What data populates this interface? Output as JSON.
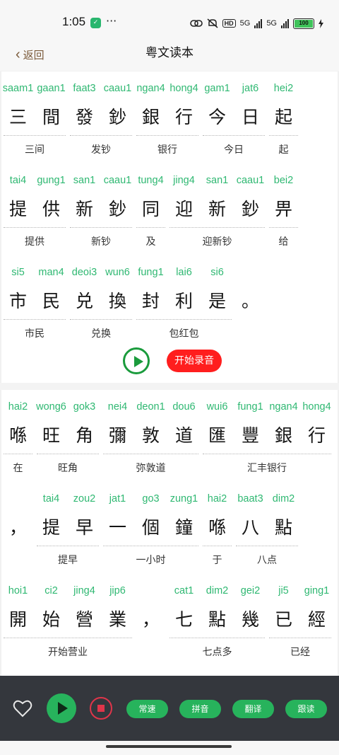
{
  "status": {
    "time": "1:05",
    "app_icon_glyph": "✓",
    "more": "···",
    "hd": "HD",
    "net1": "5G",
    "net2": "5G",
    "battery": "100"
  },
  "nav": {
    "back": "返回",
    "title": "粤文读本"
  },
  "sections": [
    {
      "rows": [
        {
          "cells": [
            [
              "saam1",
              "三"
            ],
            [
              "gaan1",
              "間"
            ],
            [
              "faat3",
              "發"
            ],
            [
              "caau1",
              "鈔"
            ],
            [
              "ngan4",
              "銀"
            ],
            [
              "hong4",
              "行"
            ],
            [
              "gam1",
              "今"
            ],
            [
              "jat6",
              "日"
            ],
            [
              "hei2",
              "起"
            ]
          ],
          "glosses": [
            {
              "text": "三间",
              "start": 0,
              "span": 2
            },
            {
              "text": "发钞",
              "start": 2,
              "span": 2
            },
            {
              "text": "银行",
              "start": 4,
              "span": 2
            },
            {
              "text": "今日",
              "start": 6,
              "span": 2
            },
            {
              "text": "起",
              "start": 8,
              "span": 1
            }
          ]
        },
        {
          "cells": [
            [
              "tai4",
              "提"
            ],
            [
              "gung1",
              "供"
            ],
            [
              "san1",
              "新"
            ],
            [
              "caau1",
              "鈔"
            ],
            [
              "tung4",
              "同"
            ],
            [
              "jing4",
              "迎"
            ],
            [
              "san1",
              "新"
            ],
            [
              "caau1",
              "鈔"
            ],
            [
              "bei2",
              "畀"
            ]
          ],
          "glosses": [
            {
              "text": "提供",
              "start": 0,
              "span": 2
            },
            {
              "text": "新钞",
              "start": 2,
              "span": 2
            },
            {
              "text": "及",
              "start": 4,
              "span": 1
            },
            {
              "text": "迎新钞",
              "start": 5,
              "span": 3
            },
            {
              "text": "给",
              "start": 8,
              "span": 1
            }
          ]
        },
        {
          "cells": [
            [
              "si5",
              "市"
            ],
            [
              "man4",
              "民"
            ],
            [
              "deoi3",
              "兑"
            ],
            [
              "wun6",
              "換"
            ],
            [
              "fung1",
              "封"
            ],
            [
              "lai6",
              "利"
            ],
            [
              "si6",
              "是"
            ],
            [
              "",
              "。"
            ]
          ],
          "glosses": [
            {
              "text": "市民",
              "start": 0,
              "span": 2
            },
            {
              "text": "兑换",
              "start": 2,
              "span": 2
            },
            {
              "text": "包红包",
              "start": 4,
              "span": 3
            }
          ]
        }
      ],
      "play_label": "播放",
      "record_label": "开始录音"
    },
    {
      "rows": [
        {
          "cells": [
            [
              "hai2",
              "喺"
            ],
            [
              "wong6",
              "旺"
            ],
            [
              "gok3",
              "角"
            ],
            [
              "nei4",
              "彌"
            ],
            [
              "deon1",
              "敦"
            ],
            [
              "dou6",
              "道"
            ],
            [
              "wui6",
              "匯"
            ],
            [
              "fung1",
              "豐"
            ],
            [
              "ngan4",
              "銀"
            ],
            [
              "hong4",
              "行"
            ]
          ],
          "glosses": [
            {
              "text": "在",
              "start": 0,
              "span": 1
            },
            {
              "text": "旺角",
              "start": 1,
              "span": 2
            },
            {
              "text": "弥敦道",
              "start": 3,
              "span": 3
            },
            {
              "text": "汇丰银行",
              "start": 6,
              "span": 4
            }
          ]
        },
        {
          "cells": [
            [
              "",
              "，"
            ],
            [
              "tai4",
              "提"
            ],
            [
              "zou2",
              "早"
            ],
            [
              "jat1",
              "一"
            ],
            [
              "go3",
              "個"
            ],
            [
              "zung1",
              "鐘"
            ],
            [
              "hai2",
              "喺"
            ],
            [
              "baat3",
              "八"
            ],
            [
              "dim2",
              "點"
            ]
          ],
          "glosses": [
            {
              "text": "提早",
              "start": 1,
              "span": 2
            },
            {
              "text": "一小时",
              "start": 3,
              "span": 3
            },
            {
              "text": "于",
              "start": 6,
              "span": 1
            },
            {
              "text": "八点",
              "start": 7,
              "span": 2
            }
          ]
        },
        {
          "cells": [
            [
              "hoi1",
              "開"
            ],
            [
              "ci2",
              "始"
            ],
            [
              "jing4",
              "營"
            ],
            [
              "jip6",
              "業"
            ],
            [
              "",
              "，"
            ],
            [
              "cat1",
              "七"
            ],
            [
              "dim2",
              "點"
            ],
            [
              "gei2",
              "幾"
            ],
            [
              "ji5",
              "已"
            ],
            [
              "ging1",
              "經"
            ]
          ],
          "glosses": [
            {
              "text": "开始营业",
              "start": 0,
              "span": 4
            },
            {
              "text": "七点多",
              "start": 5,
              "span": 3
            },
            {
              "text": "已经",
              "start": 8,
              "span": 2
            }
          ]
        }
      ]
    }
  ],
  "toolbar": {
    "speed": "常速",
    "pinyin": "拼音",
    "translate": "翻译",
    "follow": "跟读"
  },
  "colors": {
    "jyutping": "#2fb872",
    "accent_green": "#27b35c",
    "record_red": "#ff1e1e",
    "toolbar_bg": "#34373d"
  }
}
